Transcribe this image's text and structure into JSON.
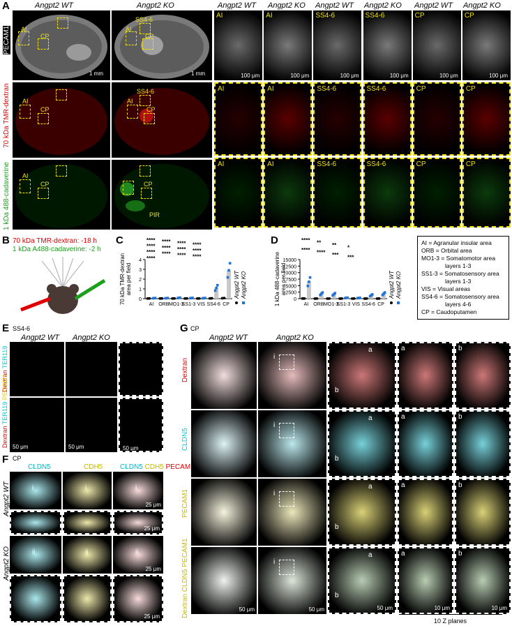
{
  "panel_A": {
    "label": "A",
    "headers": [
      "Angpt2 WT",
      "Angpt2 KO",
      "Angpt2 WT",
      "Angpt2 KO",
      "Angpt2 WT",
      "Angpt2 KO",
      "Angpt2 WT",
      "Angpt2 KO"
    ],
    "row_labels": [
      "PECAM1",
      "70 kDa TMR-dextran",
      "1 kDa 488-cadaverine"
    ],
    "region_labels": {
      "ai": "AI",
      "ss46": "SS4-6",
      "cp": "CP",
      "pir": "PIR"
    },
    "scale_1mm": "1 mm",
    "scale_100um": "100 μm"
  },
  "panel_B": {
    "label": "B",
    "line1": "70 kDa TMR-dextran: -18 h",
    "line2": "1 kDa A488-cadaverine: -2 h",
    "line1_color": "#e00000",
    "line2_color": "#1aa01a"
  },
  "panel_C": {
    "label": "C",
    "ylabel": "70 kDa TMR-dextran\narea per field",
    "legend": [
      "Angpt2 WT",
      "Angpt2 KO"
    ]
  },
  "panel_D": {
    "label": "D",
    "ylabel": "1 kDa 488-cadaverine\narea per field",
    "legend": [
      "Angpt2 WT",
      "Angpt2 KO"
    ]
  },
  "chart_data": [
    {
      "type": "scatter",
      "panel": "C",
      "categories": [
        "AI",
        "ORB",
        "MO1-3",
        "SS1-3",
        "VIS",
        "SS4-6",
        "CP"
      ],
      "ylim": [
        0,
        4
      ],
      "yticks": [
        0,
        1,
        2,
        3,
        4
      ],
      "series": [
        {
          "name": "Angpt2 WT",
          "values": [
            0.02,
            0.02,
            0.02,
            0.02,
            0.02,
            0.03,
            0.05
          ],
          "color": "#000000"
        },
        {
          "name": "Angpt2 KO",
          "values": [
            0.05,
            0.05,
            0.08,
            0.06,
            0.05,
            1.1,
            2.9
          ],
          "color": "#1e73d8"
        }
      ],
      "significance": [
        "****",
        "****",
        "****",
        "****",
        "****",
        "****",
        "****",
        "****",
        "****",
        "****",
        "****",
        "****",
        "****"
      ]
    },
    {
      "type": "scatter",
      "panel": "D",
      "categories": [
        "AI",
        "ORB",
        "MO1-3",
        "SS1-3",
        "VIS",
        "SS4-6",
        "CP"
      ],
      "ylim": [
        0,
        15000
      ],
      "yticks": [
        0,
        2500,
        5000,
        7500,
        10000,
        12500,
        15000
      ],
      "series": [
        {
          "name": "Angpt2 WT",
          "values": [
            50,
            30,
            30,
            30,
            30,
            30,
            40
          ],
          "color": "#000000"
        },
        {
          "name": "Angpt2 KO",
          "values": [
            6500,
            1900,
            1700,
            300,
            250,
            1300,
            1900
          ],
          "color": "#1e73d8"
        }
      ],
      "significance": [
        "****",
        "**",
        "**",
        "*",
        "****",
        "****",
        "***",
        "***"
      ]
    }
  ],
  "abbrev_legend": [
    "AI = Agranular insular area",
    "ORB = Orbital area",
    "MO1-3 = Somatomotor area",
    "layers 1-3",
    "SS1-3 = Somatosensory area",
    "layers 1-3",
    "VIS = Visual areas",
    "SS4-6 = Somatosensory area",
    "layers 4-6",
    "CP = Caudoputamen"
  ],
  "panel_E": {
    "label": "E",
    "region": "SS4-6",
    "headers": [
      "Angpt2 WT",
      "Angpt2 KO"
    ],
    "row1_labels": [
      "Dextran",
      "TER119"
    ],
    "row2_labels": [
      "Dextran",
      "TER119",
      "PECAM1"
    ],
    "scale": "50 μm"
  },
  "panel_F": {
    "label": "F",
    "region": "CP",
    "headers": [
      "CLDN5",
      "CDH5",
      "CLDN5",
      "CDH5",
      "PECAM1"
    ],
    "row_labels": [
      "Angpt2 WT",
      "Angpt2 KO"
    ],
    "insets": [
      "i",
      "ii"
    ],
    "scale": "25 μm"
  },
  "panel_G": {
    "label": "G",
    "region": "CP",
    "headers": [
      "Angpt2 WT",
      "Angpt2 KO"
    ],
    "row_labels": [
      "Dextran",
      "CLDN5",
      "PECAM1",
      "Dextran CLDN5 PECAM1"
    ],
    "inset_labels": [
      "i",
      "a",
      "b"
    ],
    "scale_50": "50 μm",
    "scale_10": "10 μm",
    "z_note": "10 Z planes"
  }
}
